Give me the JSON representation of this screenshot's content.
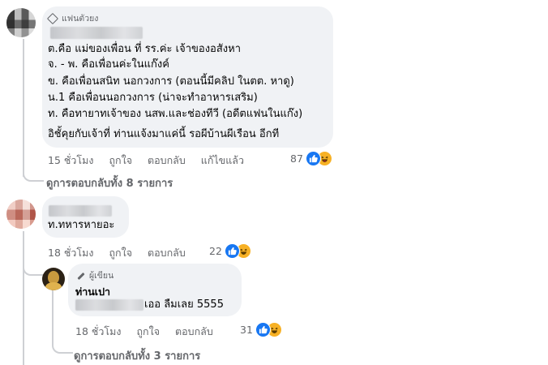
{
  "comment1": {
    "badge": "แฟนตัวยง",
    "lines": [
      "ต.คือ แม่ของเพื่อน ที่ รร.ค่ะ เจ้าของอสังหา",
      "จ. - พ. คือเพื่อนค่ะในแก๊งค์",
      "ข. คือเพื่อนสนิท นอกวงการ (ตอนนี้มีคลิป ในตต. หาดู)",
      "น.1 คือเพื่อนนอกวงการ (น่าจะทำอาหารเสริม)",
      "ท. คือทายาทเจ้าของ นสพ.และช่องทีวี (อดีตแฟนในแก๊ง)",
      "อิชั้คุยกับเจ้าที่ ท่านแจ้งมาแค่นี้ รอผีบ้านผีเรือน อีกที"
    ],
    "time": "15 ชั่วโมง",
    "like": "ถูกใจ",
    "reply": "ตอบกลับ",
    "edited": "แก้ไขแล้ว",
    "reaction_count": "87",
    "view_replies": "ดูการตอบกลับทั้ง 8 รายการ"
  },
  "comment2": {
    "text": "ท.ทหารหายอะ",
    "time": "18 ชั่วโมง",
    "like": "ถูกใจ",
    "reply": "ตอบกลับ",
    "reaction_count": "22",
    "view_replies": "ดูการตอบกลับทั้ง 3 รายการ"
  },
  "reply1": {
    "badge": "ผู้เขียน",
    "author": "ท่านเปา",
    "text": "เออ ลืมเลย 5555",
    "time": "18 ชั่วโมง",
    "like": "ถูกใจ",
    "reply": "ตอบกลับ",
    "reaction_count": "31"
  },
  "colors": {
    "like": "#1877f2",
    "haha": "#f7b125",
    "bubble": "#f0f2f5",
    "meta": "#65676b"
  },
  "icons": [
    "diamond-icon",
    "pencil-icon",
    "like-reaction-icon",
    "haha-reaction-icon"
  ]
}
